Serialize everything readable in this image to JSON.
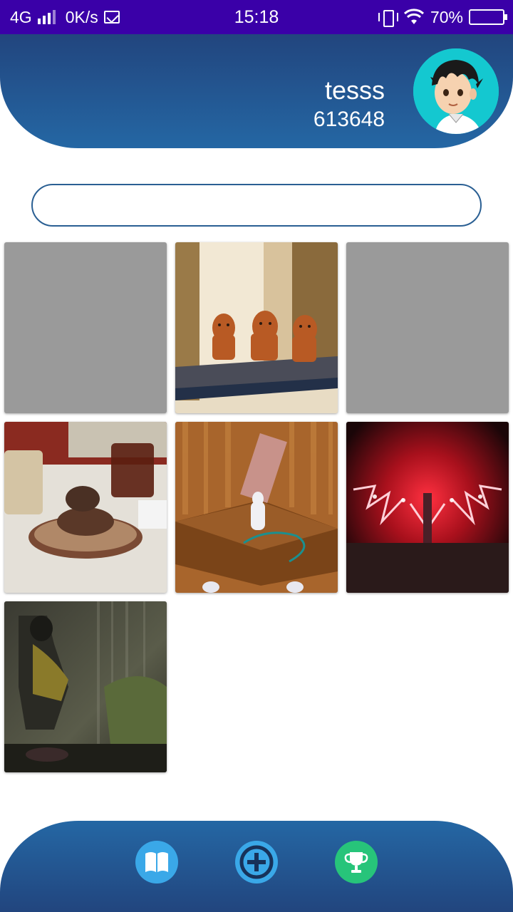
{
  "status_bar": {
    "network": "4G",
    "speed": "0K/s",
    "time": "15:18",
    "battery": "70%",
    "battery_level": 0.7,
    "battery_color": "#f6b800"
  },
  "header": {
    "username": "tesss",
    "user_id": "613648",
    "gradient_top": "#22457e",
    "gradient_bottom": "#2467a4"
  },
  "search": {
    "value": "",
    "placeholder": ""
  },
  "gallery": {
    "items": [
      {
        "name": "placeholder",
        "icon": "gray-placeholder"
      },
      {
        "name": "wooden-animals",
        "icon": "photo"
      },
      {
        "name": "placeholder",
        "icon": "gray-placeholder"
      },
      {
        "name": "dessert-table",
        "icon": "photo"
      },
      {
        "name": "shelf-figurine",
        "icon": "photo"
      },
      {
        "name": "red-swords-art",
        "icon": "photo"
      },
      {
        "name": "dark-hero-art",
        "icon": "photo"
      }
    ]
  },
  "bottom_nav": {
    "items": [
      {
        "icon": "book-icon",
        "color": "#3aa8e8"
      },
      {
        "icon": "add-icon",
        "color": "#3aa8e8"
      },
      {
        "icon": "trophy-icon",
        "color": "#27c47a"
      }
    ]
  }
}
